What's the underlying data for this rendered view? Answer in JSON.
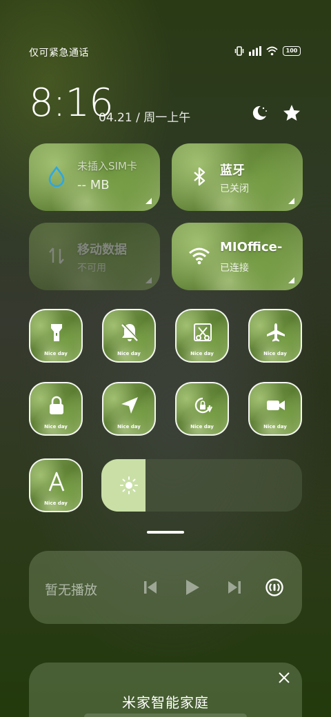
{
  "status_bar": {
    "carrier": "仅可紧急通话",
    "battery": "100"
  },
  "header": {
    "time": "8:16",
    "date": "04.21 / 周一上午"
  },
  "tiles": {
    "data_usage": {
      "title": "未插入SIM卡",
      "value": "-- MB"
    },
    "bluetooth": {
      "title": "蓝牙",
      "status": "已关闭"
    },
    "mobile_data": {
      "title": "移动数据",
      "status": "不可用"
    },
    "wifi": {
      "title": "MIOffice-",
      "status": "已连接"
    }
  },
  "toggles": [
    {
      "name": "flashlight",
      "label": "Nice day"
    },
    {
      "name": "silent",
      "label": "Nice day"
    },
    {
      "name": "screenshot",
      "label": "Nice day"
    },
    {
      "name": "airplane",
      "label": "Nice day"
    },
    {
      "name": "lock",
      "label": "Nice day"
    },
    {
      "name": "location",
      "label": "Nice day"
    },
    {
      "name": "rotation-lock",
      "label": "Nice day"
    },
    {
      "name": "screen-recorder",
      "label": "Nice day"
    },
    {
      "name": "font",
      "label": "Nice day"
    }
  ],
  "brightness": {
    "level": 0.22,
    "fill_color": "#c9dfa6"
  },
  "media": {
    "status": "暂无播放"
  },
  "smart_home": {
    "title": "米家智能家庭"
  }
}
